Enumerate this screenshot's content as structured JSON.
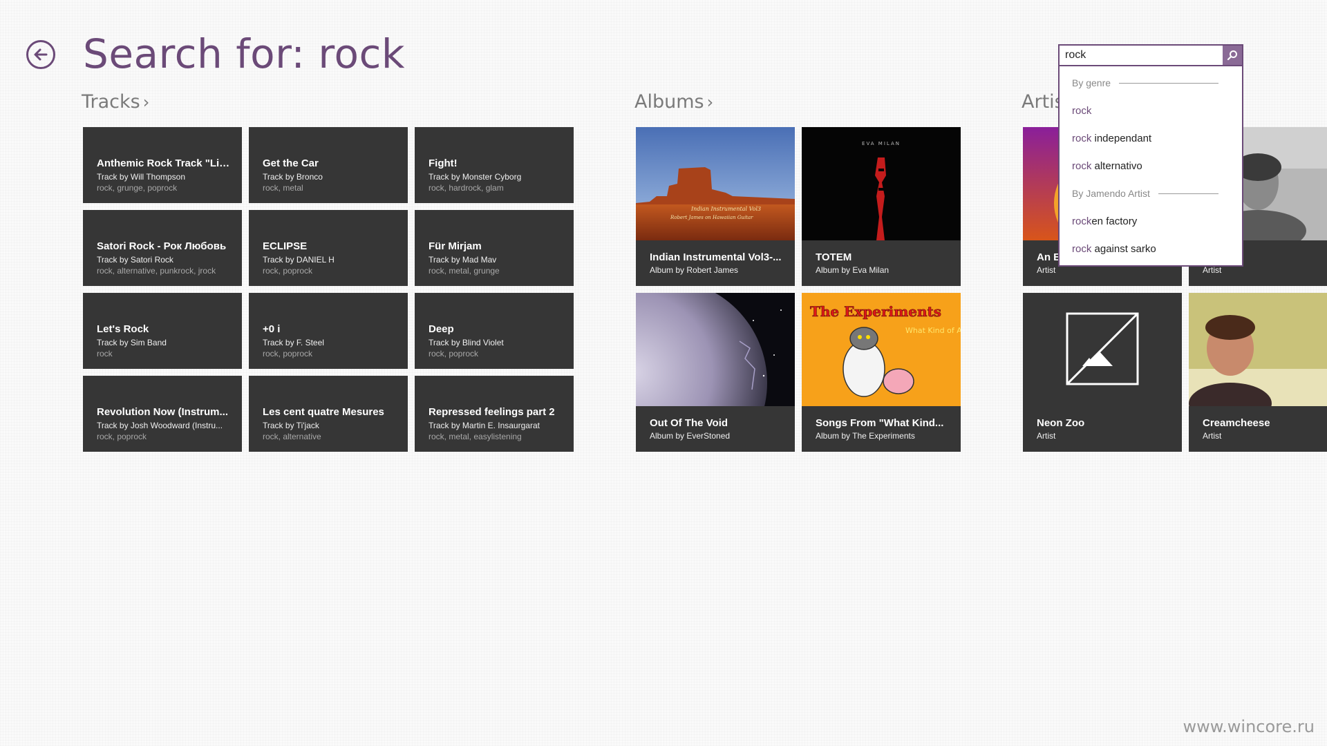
{
  "header": {
    "title": "Search for: rock"
  },
  "sections": {
    "tracks": "Tracks",
    "albums": "Albums",
    "artists": "Artis",
    "chevron": "›"
  },
  "tracks": [
    {
      "title": "Anthemic Rock Track \"Lig...",
      "sub": "Track by Will Thompson",
      "tags": "rock, grunge, poprock"
    },
    {
      "title": "Get the Car",
      "sub": "Track by Bronco",
      "tags": "rock, metal"
    },
    {
      "title": "Fight!",
      "sub": "Track by Monster Cyborg",
      "tags": "rock, hardrock, glam"
    },
    {
      "title": "Satori Rock - Рок Любовь",
      "sub": "Track by Satori Rock",
      "tags": "rock, alternative, punkrock, jrock"
    },
    {
      "title": "ECLIPSE",
      "sub": "Track by DANIEL H",
      "tags": "rock, poprock"
    },
    {
      "title": "Für Mirjam",
      "sub": "Track by Mad Mav",
      "tags": "rock, metal, grunge"
    },
    {
      "title": "Let's Rock",
      "sub": "Track by Sim Band",
      "tags": "rock"
    },
    {
      "title": "+0 i",
      "sub": "Track by F. Steel",
      "tags": "rock, poprock"
    },
    {
      "title": "Deep",
      "sub": "Track by Blind Violet",
      "tags": "rock, poprock"
    },
    {
      "title": "Revolution Now (Instrum...",
      "sub": "Track by Josh Woodward (Instru...",
      "tags": "rock, poprock"
    },
    {
      "title": "Les cent quatre Mesures",
      "sub": "Track by Ti'jack",
      "tags": "rock, alternative"
    },
    {
      "title": "Repressed feelings part 2",
      "sub": "Track by Martin E. Insaurgarat",
      "tags": "rock, metal, easylistening"
    }
  ],
  "albums": [
    {
      "title": "Indian Instrumental Vol3-...",
      "sub": "Album by Robert James",
      "art_text_1": "Indian Instrumental Vol3",
      "art_text_2": "Robert James on Hawaiian Guitar"
    },
    {
      "title": "TOTEM",
      "sub": "Album by Eva Milan",
      "art_text_1": "EVA MILAN"
    },
    {
      "title": "Out Of The Void",
      "sub": "Album by EverStoned"
    },
    {
      "title": "Songs From \"What Kind...",
      "sub": "Album by The Experiments",
      "art_text_1": "The Experiments",
      "art_text_2": "What Kind of Animal ?"
    }
  ],
  "artists": [
    {
      "title": "An E",
      "sub": "Artist"
    },
    {
      "title": "",
      "sub": "Artist"
    },
    {
      "title": "Neon Zoo",
      "sub": "Artist"
    },
    {
      "title": "Creamcheese",
      "sub": "Artist"
    }
  ],
  "search": {
    "value": "rock",
    "suggestions": {
      "group1": "By genre",
      "item1_hl": "rock",
      "item1_rest": "",
      "item2_hl": "rock",
      "item2_rest": " independant",
      "item3_hl": "rock",
      "item3_rest": " alternativo",
      "group2": "By Jamendo Artist",
      "item4_hl": "rock",
      "item4_rest": "en factory",
      "item5_hl": "rock",
      "item5_rest": " against sarko"
    }
  },
  "watermark": "www.wincore.ru",
  "colors": {
    "accent": "#6b4a78",
    "tile": "#363636",
    "background": "#fafafa"
  },
  "icons": [
    "back-arrow-icon",
    "search-icon",
    "chevron-right-icon",
    "artist-placeholder-icon"
  ]
}
